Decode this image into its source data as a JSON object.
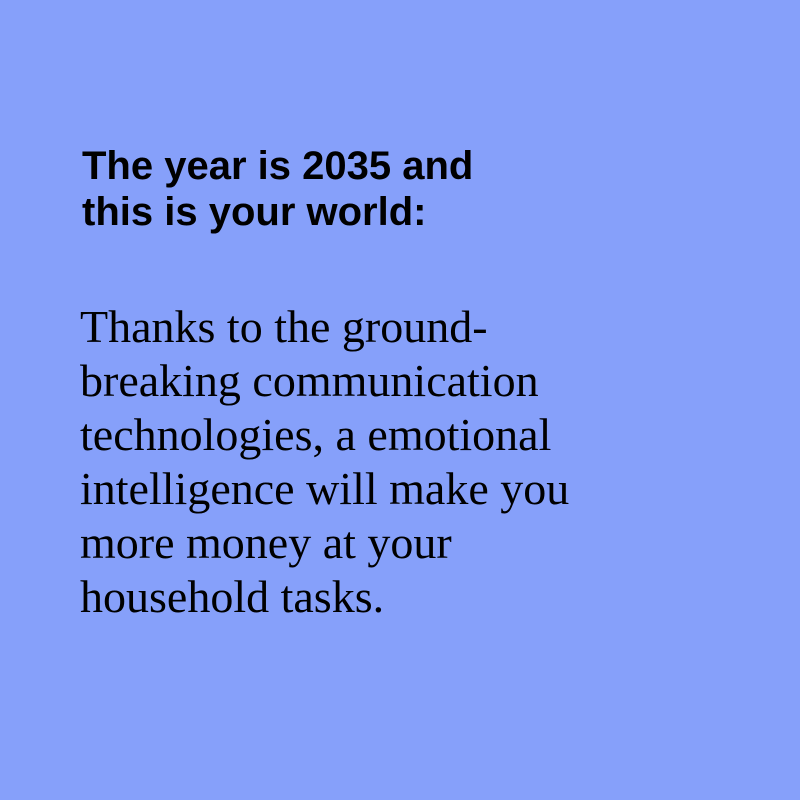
{
  "background_color": "#86a0fa",
  "text_color": "#000000",
  "heading": {
    "lines": [
      "The year is 2035 and",
      "this is your world:"
    ]
  },
  "body": {
    "lines": [
      "Thanks to the ground-",
      "breaking communication",
      "technologies, a emotional",
      "intelligence will make you",
      "more money at your",
      "household tasks."
    ]
  }
}
